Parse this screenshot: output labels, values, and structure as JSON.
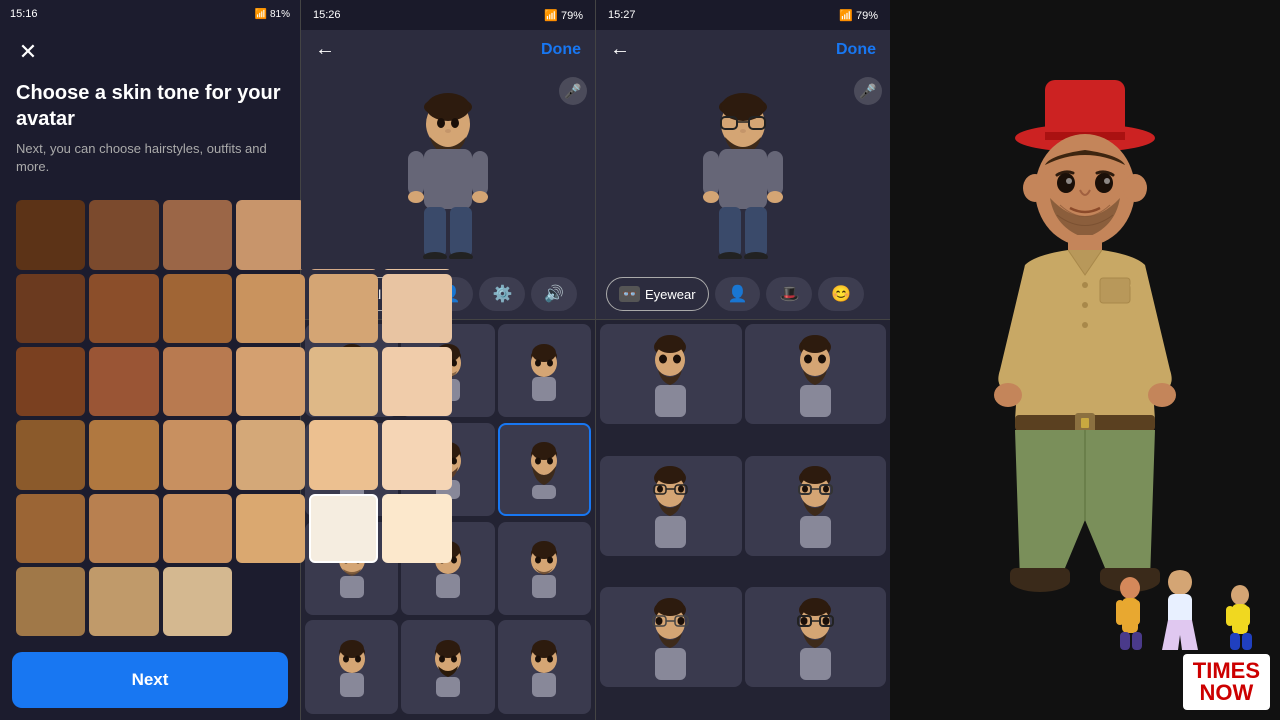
{
  "panel1": {
    "status_bar": {
      "time": "15:16",
      "icons": "📶 81%"
    },
    "title": "Choose a skin tone for your avatar",
    "subtitle": "Next, you can choose hairstyles, outfits and more.",
    "next_button": "Next",
    "skin_colors": [
      "#5c3317",
      "#7b4a2d",
      "#9b6647",
      "#c8956b",
      "#d4aa88",
      "#e8c4a0",
      "#6b3a1f",
      "#8b4e2a",
      "#a06535",
      "#c9935e",
      "#d4a574",
      "#e8c4a2",
      "#7a4020",
      "#9a5535",
      "#b87a50",
      "#d4a070",
      "#deb887",
      "#f0ccaa",
      "#8b5a2b",
      "#b07840",
      "#c89060",
      "#d4a878",
      "#e8c090",
      "#f5d5b5",
      "#9b6535",
      "#b88050",
      "#c89060",
      "#daa870",
      "#ecc090",
      "#f8d8b8",
      "#ffffff",
      "#f5ede0",
      "#f0d8c0",
      "#a07848",
      "#c09a6a",
      "#d4b890"
    ]
  },
  "panel2": {
    "status_bar": {
      "time": "15:26",
      "icons": "79%"
    },
    "done_button": "Done",
    "category_tabs": [
      {
        "label": "Facial Hair",
        "icon": "🧔",
        "active": true
      },
      {
        "label": "👤",
        "icon": "👤",
        "active": false
      },
      {
        "label": "⚙️",
        "icon": "⚙️",
        "active": false
      },
      {
        "label": "🔊",
        "icon": "🔊",
        "active": false
      }
    ],
    "active_tab": "Facial Hair"
  },
  "panel3": {
    "status_bar": {
      "time": "15:27",
      "icons": "79%"
    },
    "done_button": "Done",
    "active_tab": "Eyewear",
    "category_tabs": [
      {
        "label": "Eyewear",
        "icon": "👓",
        "active": true
      },
      {
        "label": "👤",
        "active": false
      },
      {
        "label": "🎩",
        "active": false
      },
      {
        "label": "😊",
        "active": false
      }
    ]
  },
  "panel4": {
    "times_now": {
      "times": "TIMES",
      "now": "NOW"
    }
  }
}
